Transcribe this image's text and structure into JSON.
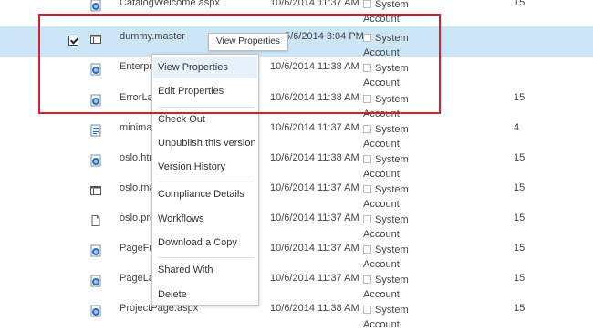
{
  "rows": [
    {
      "name": "CatalogWelcome.aspx",
      "modified": "10/6/2014 11:37 AM",
      "by_line1": "System",
      "by_line2": "Account",
      "version": "15",
      "icon": "aspx-page-icon"
    },
    {
      "name": "dummy.master",
      "modified": "5/6/2014 3:04 PM",
      "by_line1": "System",
      "by_line2": "Account",
      "version": "",
      "icon": "master-page-icon"
    },
    {
      "name": "Enterpr",
      "modified": "10/6/2014 11:38 AM",
      "by_line1": "System",
      "by_line2": "Account",
      "version": "",
      "icon": "aspx-page-icon"
    },
    {
      "name": "ErrorLay",
      "modified": "10/6/2014 11:38 AM",
      "by_line1": "System",
      "by_line2": "Account",
      "version": "15",
      "icon": "aspx-page-icon"
    },
    {
      "name": "minima",
      "modified": "10/6/2014 11:37 AM",
      "by_line1": "System",
      "by_line2": "Account",
      "version": "4",
      "icon": "document-icon"
    },
    {
      "name": "oslo.htr",
      "modified": "10/6/2014 11:38 AM",
      "by_line1": "System",
      "by_line2": "Account",
      "version": "15",
      "icon": "aspx-page-icon"
    },
    {
      "name": "oslo.ma",
      "modified": "10/6/2014 11:37 AM",
      "by_line1": "System",
      "by_line2": "Account",
      "version": "15",
      "icon": "master-page-icon"
    },
    {
      "name": "oslo.pre",
      "modified": "10/6/2014 11:37 AM",
      "by_line1": "System",
      "by_line2": "Account",
      "version": "15",
      "icon": "blank-file-icon"
    },
    {
      "name": "PageFro",
      "modified": "10/6/2014 11:37 AM",
      "by_line1": "System",
      "by_line2": "Account",
      "version": "15",
      "icon": "aspx-page-icon"
    },
    {
      "name": "PageLay",
      "modified": "10/6/2014 11:37 AM",
      "by_line1": "System",
      "by_line2": "Account",
      "version": "15",
      "icon": "aspx-page-icon"
    },
    {
      "name": "ProjectPage.aspx",
      "modified": "10/6/2014 11:38 AM",
      "by_line1": "System",
      "by_line2": "Account",
      "version": "15",
      "icon": "aspx-page-icon"
    }
  ],
  "tooltip": "View Properties",
  "menu": {
    "items": [
      "View Properties",
      "Edit Properties",
      "Check Out",
      "Unpublish this version",
      "Version History",
      "Compliance Details",
      "Workflows",
      "Download a Copy",
      "Shared With",
      "Delete"
    ]
  },
  "colors": {
    "selected_row": "#cde6f7",
    "highlight_box": "#d4202a",
    "menu_hover": "#e6f1fb"
  }
}
